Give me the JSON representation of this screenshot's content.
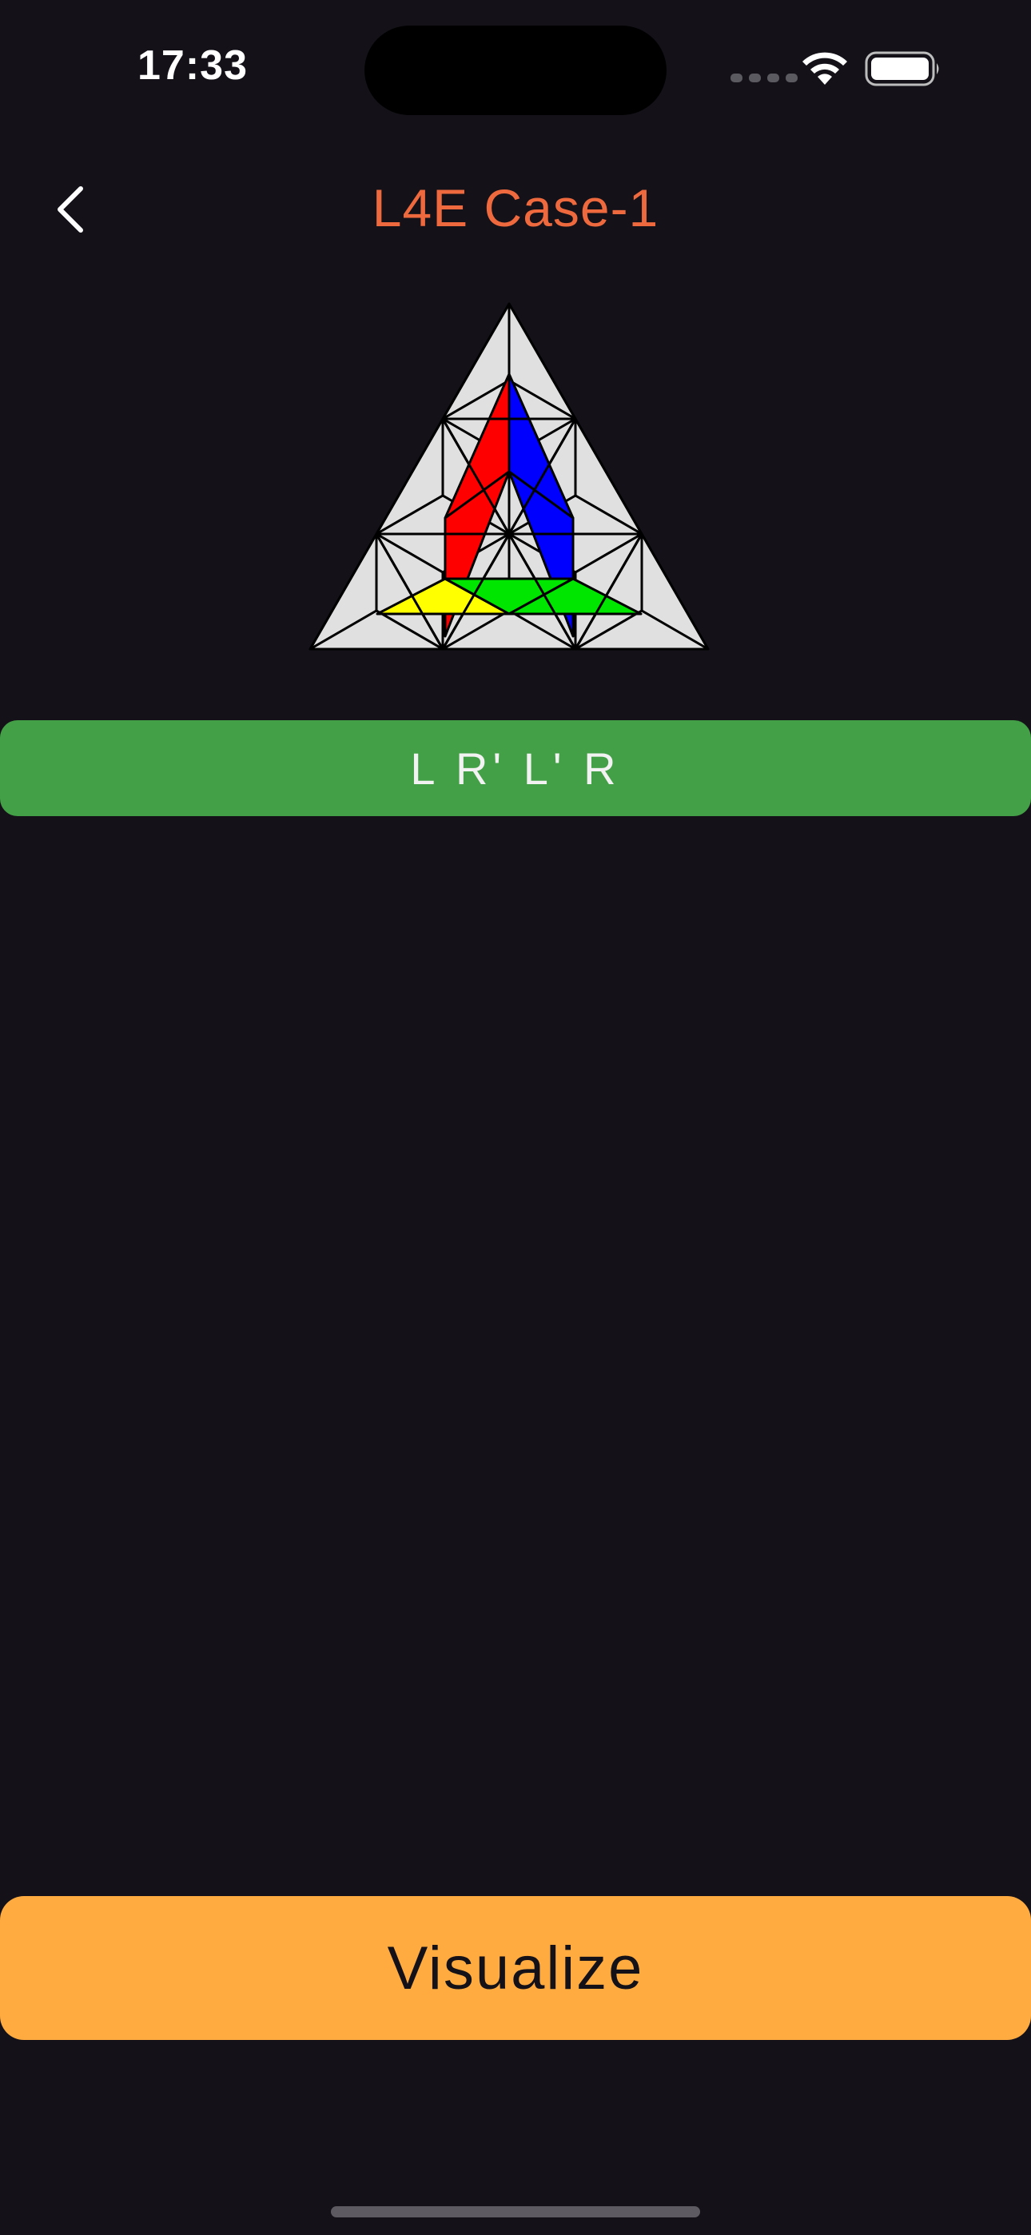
{
  "status_bar": {
    "time": "17:33"
  },
  "nav": {
    "back_icon": "chevron-left-icon",
    "title": "L4E Case-1"
  },
  "diagram": {
    "sticker_colors": {
      "base": "#e0e0e0",
      "red": "#ff0000",
      "blue": "#0000ff",
      "yellow": "#ffff00",
      "green": "#00e600",
      "outline": "#000000"
    }
  },
  "algorithm": {
    "moves": "L R' L' R"
  },
  "actions": {
    "visualize_label": "Visualize"
  },
  "colors": {
    "background": "#141218",
    "title_accent": "#ee6a3e",
    "algorithm_bar": "#43a047",
    "visualize_button": "#ffab40"
  }
}
